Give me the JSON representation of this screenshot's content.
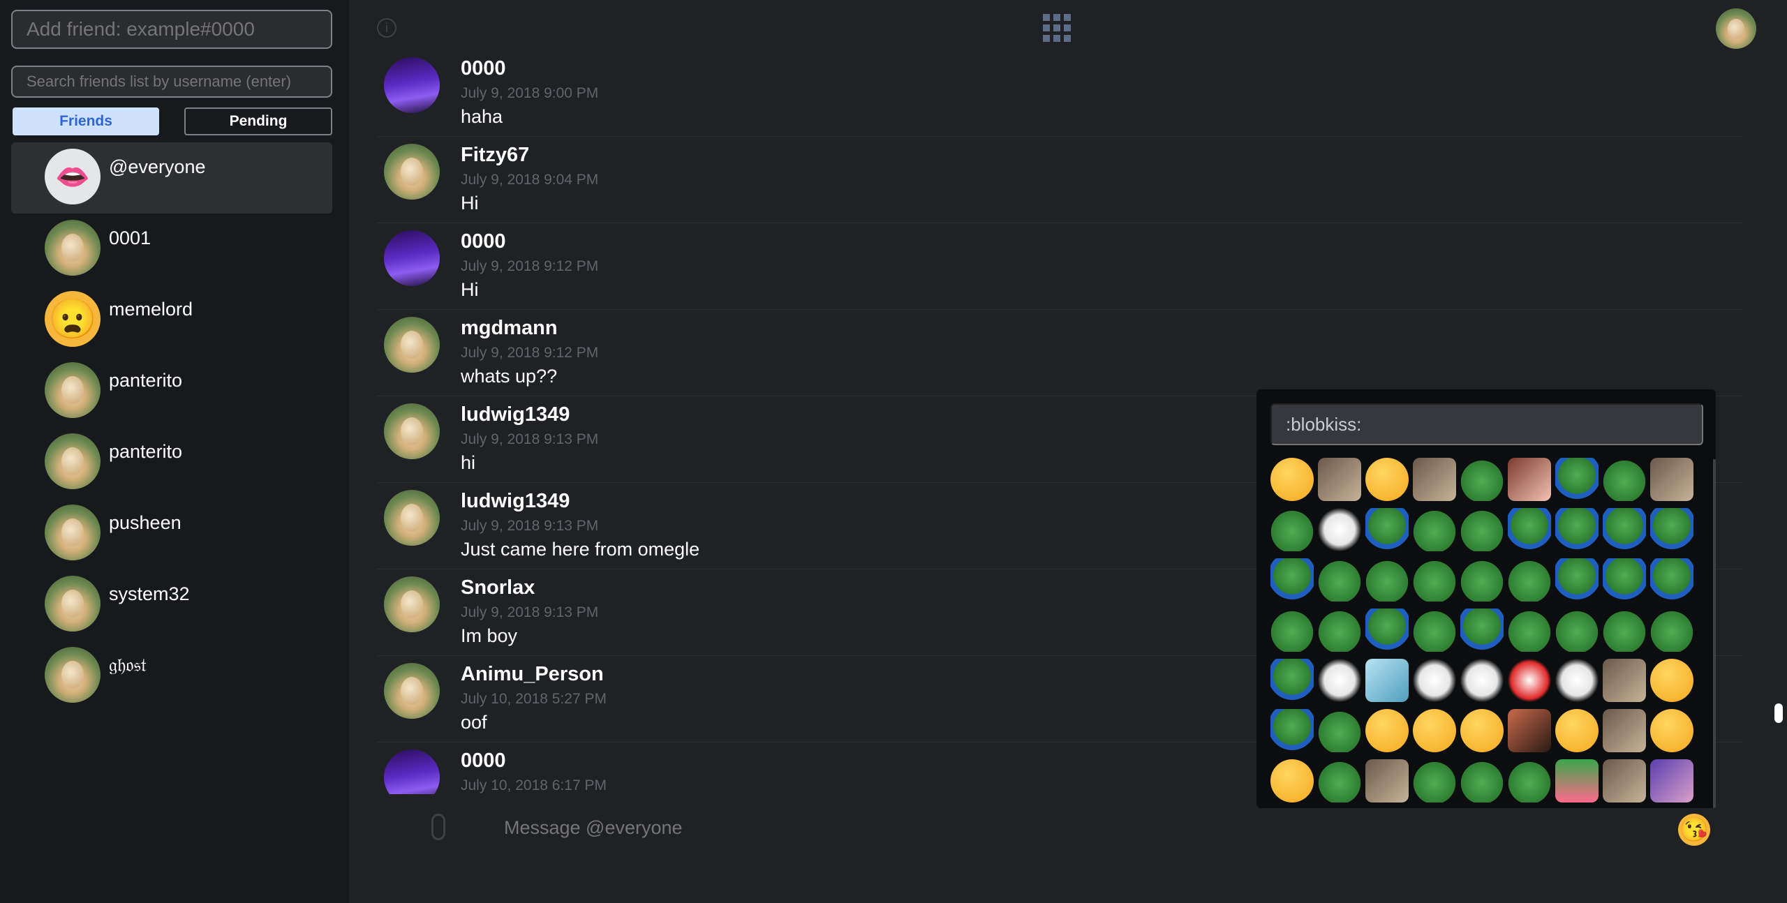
{
  "sidebar": {
    "add_friend_placeholder": "Add friend: example#0000",
    "search_placeholder": "Search friends list by username (enter)",
    "tabs": {
      "friends": "Friends",
      "pending": "Pending"
    },
    "friends": [
      {
        "name": "@everyone",
        "avatar": "lips"
      },
      {
        "name": "0001",
        "avatar": "dog"
      },
      {
        "name": "memelord",
        "avatar": "emoji-face"
      },
      {
        "name": "panterito",
        "avatar": "dog"
      },
      {
        "name": "panterito",
        "avatar": "dog"
      },
      {
        "name": "pusheen",
        "avatar": "dog"
      },
      {
        "name": "system32",
        "avatar": "dog"
      },
      {
        "name": "𝔤𝔥𝔬𝔰𝔱",
        "avatar": "dog"
      }
    ]
  },
  "header": {
    "info_icon": "info-icon",
    "apps_icon": "grid-icon"
  },
  "messages": [
    {
      "author": "0000",
      "time": "July 9, 2018 9:00 PM",
      "text": "haha",
      "avatar": "purple"
    },
    {
      "author": "Fitzy67",
      "time": "July 9, 2018 9:04 PM",
      "text": "Hi",
      "avatar": "dog"
    },
    {
      "author": "0000",
      "time": "July 9, 2018 9:12 PM",
      "text": "Hi",
      "avatar": "purple"
    },
    {
      "author": "mgdmann",
      "time": "July 9, 2018 9:12 PM",
      "text": "whats up??",
      "avatar": "dog"
    },
    {
      "author": "ludwig1349",
      "time": "July 9, 2018 9:13 PM",
      "text": "hi",
      "avatar": "dog"
    },
    {
      "author": "ludwig1349",
      "time": "July 9, 2018 9:13 PM",
      "text": "Just came here from omegle",
      "avatar": "dog"
    },
    {
      "author": "Snorlax",
      "time": "July 9, 2018 9:13 PM",
      "text": "Im boy",
      "avatar": "dog"
    },
    {
      "author": "Animu_Person",
      "time": "July 10, 2018 5:27 PM",
      "text": "oof",
      "avatar": "dog"
    },
    {
      "author": "0000",
      "time": "July 10, 2018 6:17 PM",
      "text": "",
      "avatar": "purple"
    }
  ],
  "composer": {
    "placeholder": "Message @everyone",
    "emoji_button_icon": "kissing-face-icon"
  },
  "emoji_picker": {
    "search_value": ":blobkiss:"
  },
  "colors": {
    "background": "#1f2124",
    "sidebar": "#18191c",
    "friends_tab_active": "#cfe2fb",
    "friends_tab_text": "#2d65d8"
  }
}
